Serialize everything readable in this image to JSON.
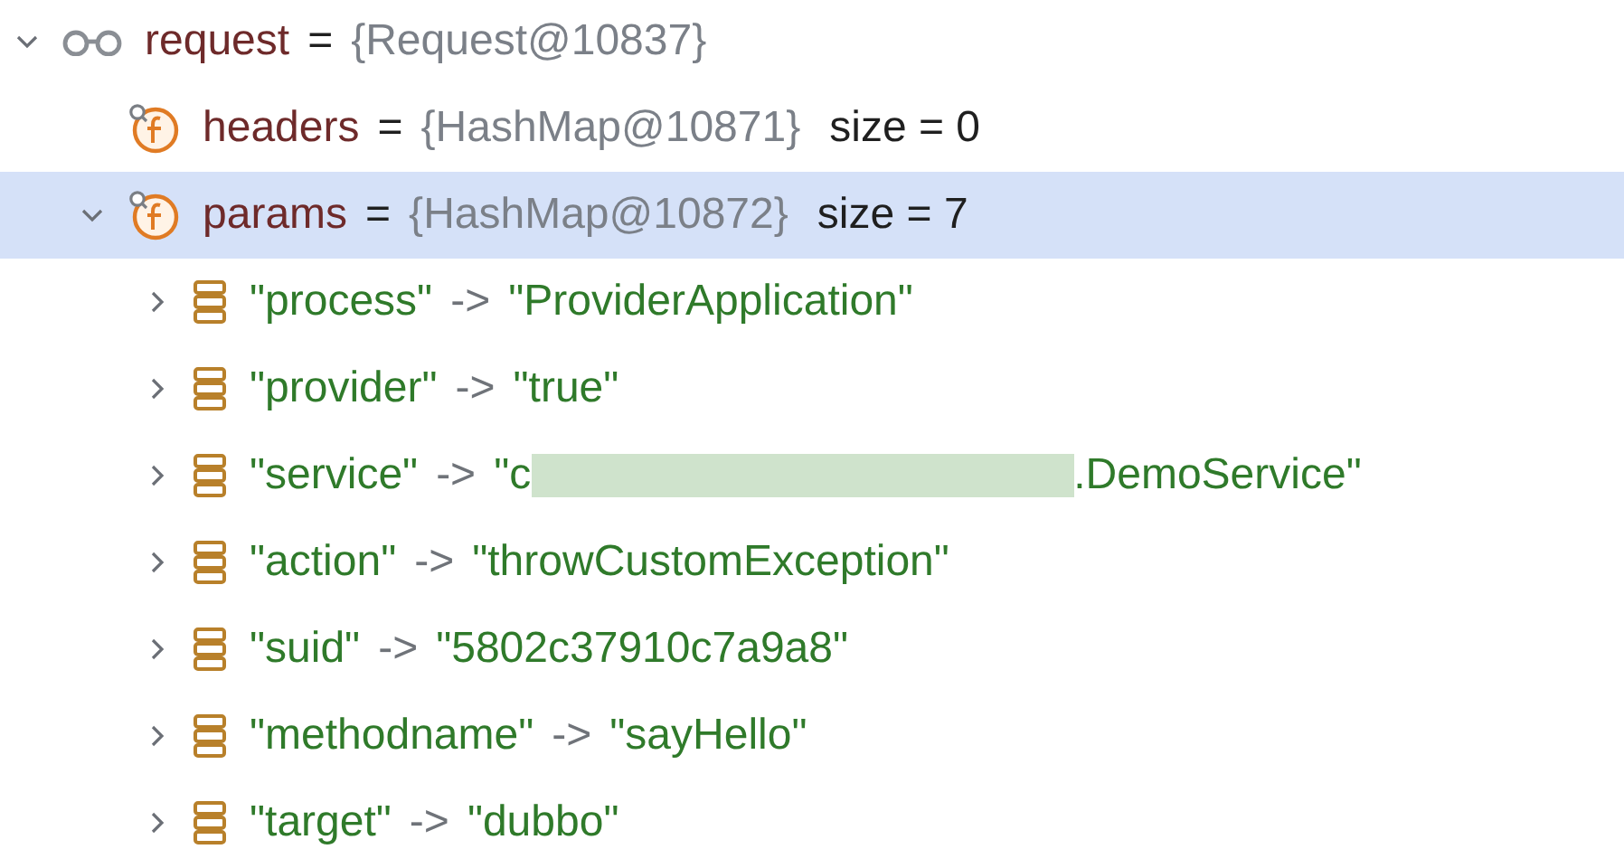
{
  "tree": [
    {
      "kind": "watch",
      "name": "request",
      "op": "=",
      "value": "{Request@10837}",
      "expandable": true,
      "expanded": true,
      "selected": false,
      "children": [
        {
          "kind": "field",
          "name": "headers",
          "op": "=",
          "value": "{HashMap@10871}",
          "extra": "size = 0",
          "expandable": false,
          "selected": false
        },
        {
          "kind": "field",
          "name": "params",
          "op": "=",
          "value": "{HashMap@10872}",
          "extra": "size = 7",
          "expandable": true,
          "expanded": true,
          "selected": true,
          "children": [
            {
              "kind": "entry",
              "name": "\"process\"",
              "op": "->",
              "value": "\"ProviderApplication\"",
              "expandable": true,
              "expanded": false,
              "selected": false
            },
            {
              "kind": "entry",
              "name": "\"provider\"",
              "op": "->",
              "value": "\"true\"",
              "expandable": true,
              "expanded": false,
              "selected": false
            },
            {
              "kind": "entry",
              "name": "\"service\"",
              "op": "->",
              "value": "\"c",
              "redacted": true,
              "value_after": ".DemoService\"",
              "expandable": true,
              "expanded": false,
              "selected": false
            },
            {
              "kind": "entry",
              "name": "\"action\"",
              "op": "->",
              "value": "\"throwCustomException\"",
              "expandable": true,
              "expanded": false,
              "selected": false
            },
            {
              "kind": "entry",
              "name": "\"suid\"",
              "op": "->",
              "value": "\"5802c37910c7a9a8\"",
              "expandable": true,
              "expanded": false,
              "selected": false
            },
            {
              "kind": "entry",
              "name": "\"methodname\"",
              "op": "->",
              "value": "\"sayHello\"",
              "expandable": true,
              "expanded": false,
              "selected": false
            },
            {
              "kind": "entry",
              "name": "\"target\"",
              "op": "->",
              "value": "\"dubbo\"",
              "expandable": true,
              "expanded": false,
              "selected": false
            }
          ]
        }
      ]
    }
  ]
}
